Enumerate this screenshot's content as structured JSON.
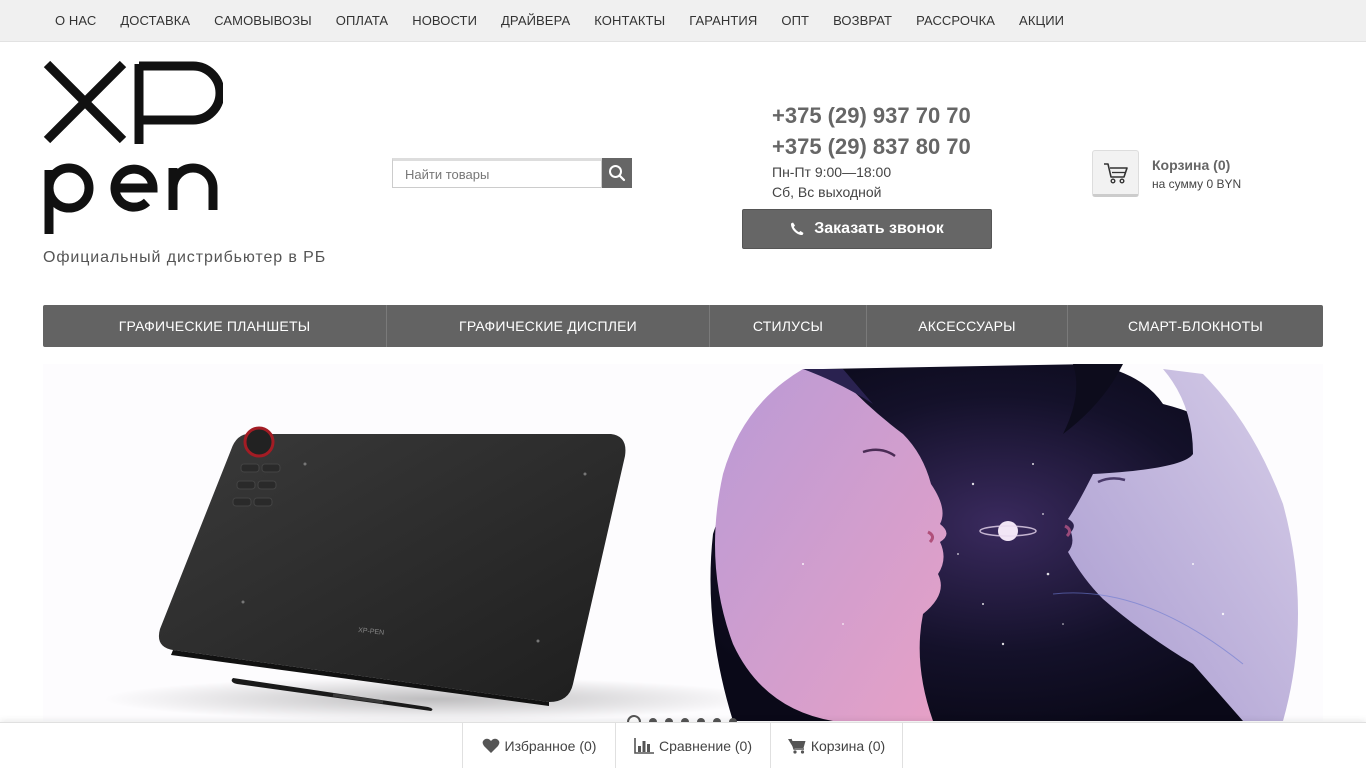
{
  "top_nav": [
    {
      "label": "О НАС"
    },
    {
      "label": "ДОСТАВКА"
    },
    {
      "label": "САМОВЫВОЗЫ"
    },
    {
      "label": "ОПЛАТА"
    },
    {
      "label": "НОВОСТИ"
    },
    {
      "label": "ДРАЙВЕРА"
    },
    {
      "label": "КОНТАКТЫ"
    },
    {
      "label": "ГАРАНТИЯ"
    },
    {
      "label": "ОПТ"
    },
    {
      "label": "ВОЗВРАТ"
    },
    {
      "label": "РАССРОЧКА"
    },
    {
      "label": "АКЦИИ"
    }
  ],
  "header": {
    "tagline": "Официальный дистрибьютер в РБ",
    "search_placeholder": "Найти товары",
    "phone_1": "+375 (29) 937 70 70",
    "phone_2": "+375 (29) 837 80 70",
    "hours_weekdays": "Пн-Пт 9:00—18:00",
    "hours_weekend": "Сб, Вс выходной",
    "callback_label": "Заказать звонок",
    "cart_title": "Корзина (0)",
    "cart_sum": "на сумму 0 BYN"
  },
  "categories": [
    {
      "label": "ГРАФИЧЕСКИЕ ПЛАНШЕТЫ"
    },
    {
      "label": "ГРАФИЧЕСКИЕ ДИСПЛЕИ"
    },
    {
      "label": "СТИЛУСЫ"
    },
    {
      "label": "АКСЕССУАРЫ"
    },
    {
      "label": "СМАРТ-БЛОКНОТЫ"
    }
  ],
  "banner": {
    "tablet_brand_text": "XP-PEN",
    "slide_count": 7,
    "active_slide": 1
  },
  "bottom_bar": {
    "favorites": "Избранное (0)",
    "compare": "Сравнение (0)",
    "cart": "Корзина (0)"
  },
  "colors": {
    "menu_bg": "#636363",
    "button_bg": "#666666",
    "topnav_bg": "#f0f0f0"
  }
}
